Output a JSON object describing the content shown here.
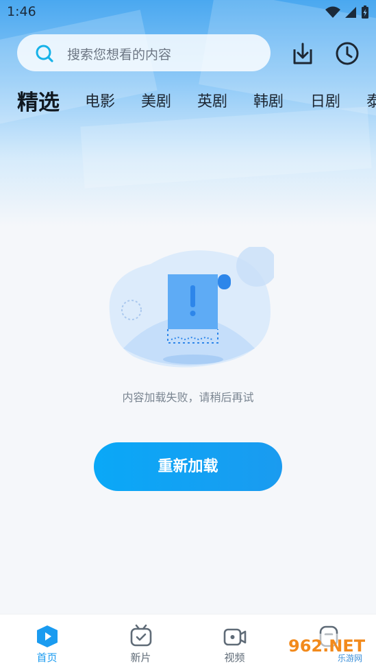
{
  "status": {
    "time": "1:46"
  },
  "search": {
    "placeholder": "搜索您想看的内容"
  },
  "header": {
    "download_icon": "download-icon",
    "history_icon": "clock-icon"
  },
  "tabs": [
    {
      "label": "精选",
      "active": true
    },
    {
      "label": "电影"
    },
    {
      "label": "美剧"
    },
    {
      "label": "英剧"
    },
    {
      "label": "韩剧"
    },
    {
      "label": "日剧"
    },
    {
      "label": "泰"
    }
  ],
  "error": {
    "message": "内容加载失败，请稍后再试",
    "button": "重新加载"
  },
  "nav": [
    {
      "label": "首页",
      "icon": "play-icon",
      "active": true
    },
    {
      "label": "新片",
      "icon": "tv-check-icon"
    },
    {
      "label": "视频",
      "icon": "video-camera-icon"
    },
    {
      "label": "",
      "icon": "profile-icon"
    }
  ],
  "watermark": {
    "text": "962.NET",
    "subtext": "乐游网"
  },
  "colors": {
    "accent": "#1a9bf0",
    "text_dark": "#1d2733",
    "muted": "#7a8591"
  }
}
